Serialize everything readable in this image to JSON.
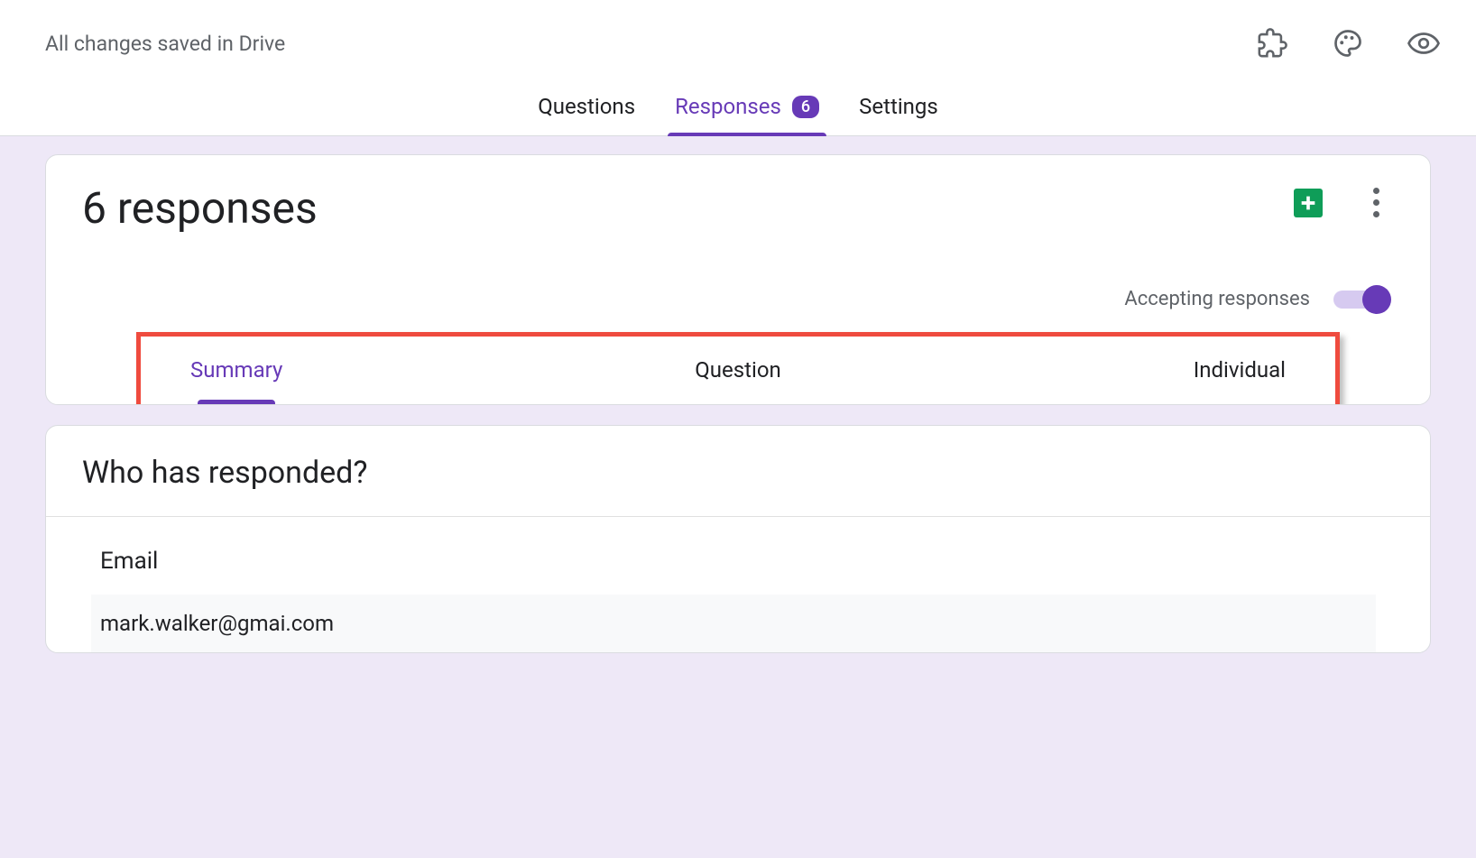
{
  "header": {
    "save_status": "All changes saved in Drive"
  },
  "main_tabs": {
    "questions": "Questions",
    "responses": "Responses",
    "responses_count": "6",
    "settings": "Settings"
  },
  "responses_card": {
    "title": "6 responses",
    "accepting_label": "Accepting responses"
  },
  "sub_tabs": {
    "summary": "Summary",
    "question": "Question",
    "individual": "Individual"
  },
  "respondents": {
    "title": "Who has responded?",
    "email_label": "Email",
    "emails": [
      "mark.walker@gmai.com"
    ]
  }
}
